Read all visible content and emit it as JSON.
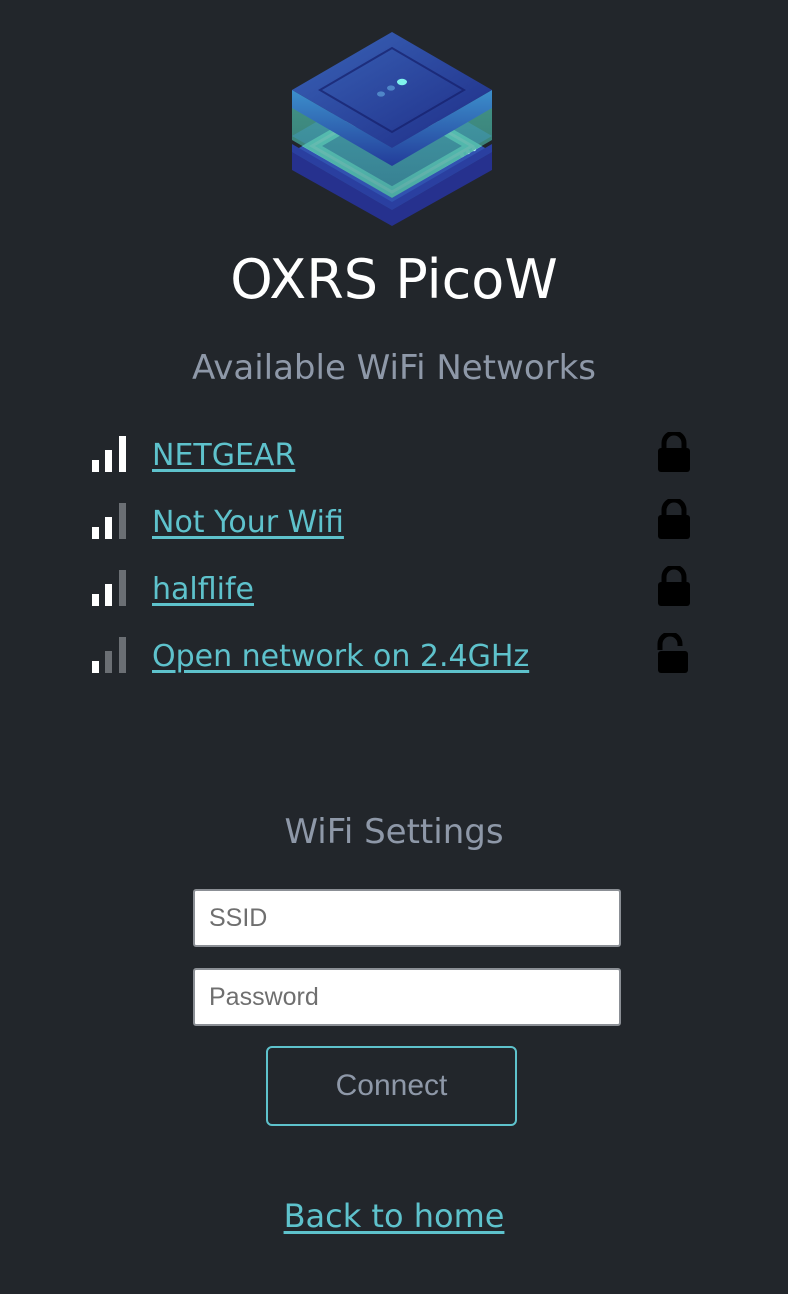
{
  "app": {
    "title": "OXRS PicoW",
    "logo_icon": "layered-device-logo"
  },
  "networks_section": {
    "heading": "Available WiFi Networks",
    "networks": [
      {
        "ssid": "NETGEAR",
        "signal_bars": 3,
        "locked": true
      },
      {
        "ssid": "Not Your Wifi",
        "signal_bars": 2,
        "locked": true
      },
      {
        "ssid": "halflife",
        "signal_bars": 2,
        "locked": true
      },
      {
        "ssid": "Open network on 2.4GHz",
        "signal_bars": 1,
        "locked": false
      }
    ]
  },
  "settings_section": {
    "heading": "WiFi Settings",
    "ssid_placeholder": "SSID",
    "ssid_value": "",
    "password_placeholder": "Password",
    "password_value": "",
    "connect_label": "Connect"
  },
  "footer": {
    "back_link": "Back to home"
  },
  "colors": {
    "background": "#22262b",
    "accent": "#5ec2cc",
    "muted_text": "#8e98a8",
    "signal_on": "#ffffff",
    "signal_off": "#6b6f74",
    "lock": "#000000"
  }
}
